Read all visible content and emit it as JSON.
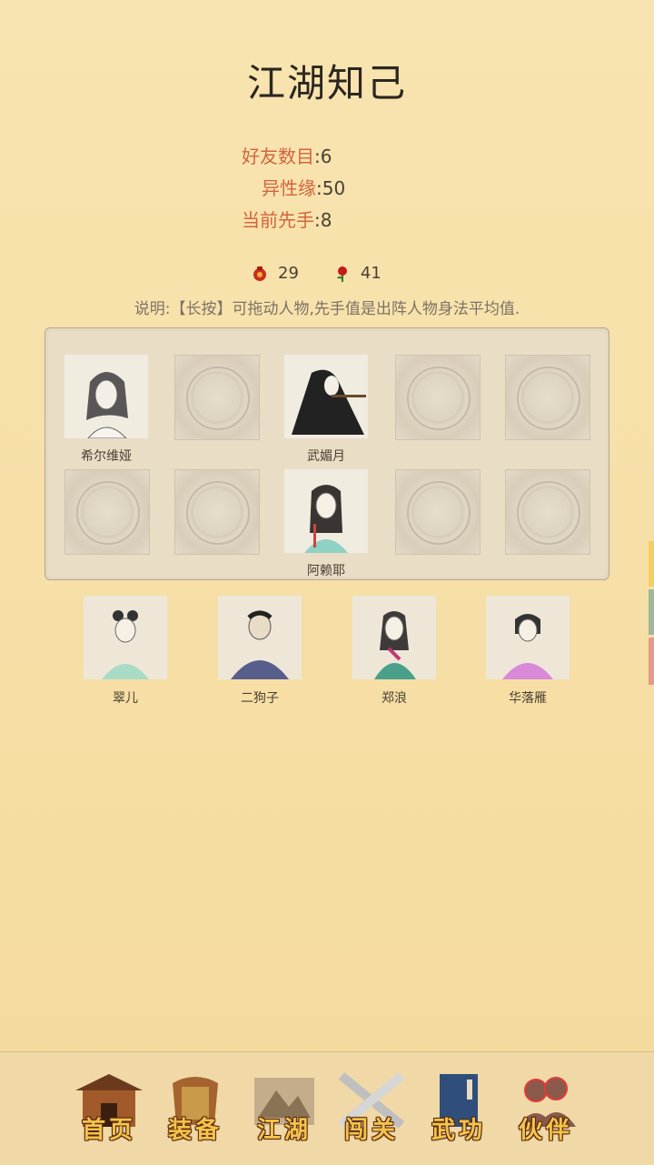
{
  "header": {
    "title": "江湖知己"
  },
  "stats": [
    {
      "label": "好友数目",
      "value": "6"
    },
    {
      "label": "异性缘",
      "value": "50"
    },
    {
      "label": "当前先手",
      "value": "8"
    }
  ],
  "currency": [
    {
      "icon": "red-pouch-icon",
      "value": "29"
    },
    {
      "icon": "rose-icon",
      "value": "41"
    }
  ],
  "note": "说明:【长按】可拖动人物,先手值是出阵人物身法平均值.",
  "formation": {
    "row1": [
      "希尔维娅",
      "",
      "武媚月",
      "",
      ""
    ],
    "row2": [
      "",
      "",
      "阿赖耶",
      "",
      ""
    ]
  },
  "bench": [
    "翠儿",
    "二狗子",
    "郑浪",
    "华落雁"
  ],
  "nav": [
    "首页",
    "装备",
    "江湖",
    "闯关",
    "武功",
    "伙伴"
  ],
  "colors": {
    "accent_label": "#d2643f",
    "panel_bg": "#eaddc6",
    "nav_text": "#f3c34b"
  }
}
